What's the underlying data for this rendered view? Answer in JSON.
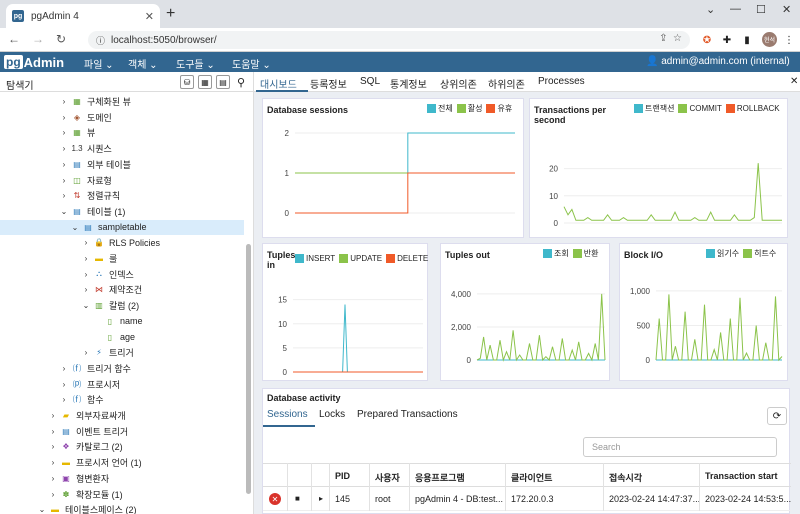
{
  "browser": {
    "tab_title": "pgAdmin 4",
    "favicon": "pg",
    "url": "localhost:5050/browser/",
    "profile_initials": "현석"
  },
  "navbar": {
    "logo_pg": "pg",
    "logo_admin": "Admin",
    "menus": [
      "파일 ⌄",
      "객체 ⌄",
      "도구들 ⌄",
      "도움말 ⌄"
    ],
    "user": "admin@admin.com (internal) ⌄"
  },
  "left_panel": {
    "title": "탐색기"
  },
  "tree": [
    {
      "label": "구체화된 뷰",
      "indent": 1,
      "chev": "›",
      "icon": "▦",
      "color": "#5c9e2f"
    },
    {
      "label": "도메인",
      "indent": 1,
      "chev": "›",
      "icon": "◈",
      "color": "#a0522d"
    },
    {
      "label": "뷰",
      "indent": 1,
      "chev": "›",
      "icon": "▦",
      "color": "#5c9e2f"
    },
    {
      "label": "시퀀스",
      "indent": 1,
      "chev": "›",
      "icon": "1.3",
      "color": "#333"
    },
    {
      "label": "외부 테이블",
      "indent": 1,
      "chev": "›",
      "icon": "▤",
      "color": "#2d7ab8"
    },
    {
      "label": "자료형",
      "indent": 1,
      "chev": "›",
      "icon": "◫",
      "color": "#5c9e2f"
    },
    {
      "label": "정렬규칙",
      "indent": 1,
      "chev": "›",
      "icon": "⇅",
      "color": "#c0392b"
    },
    {
      "label": "테이블 (1)",
      "indent": 1,
      "chev": "⌄",
      "icon": "▤",
      "color": "#2d7ab8"
    },
    {
      "label": "sampletable",
      "indent": 2,
      "chev": "⌄",
      "icon": "▤",
      "color": "#2d7ab8",
      "selected": true
    },
    {
      "label": "RLS Policies",
      "indent": 3,
      "chev": "›",
      "icon": "🔒",
      "color": "#5c9e2f"
    },
    {
      "label": "룰",
      "indent": 3,
      "chev": "›",
      "icon": "▬",
      "color": "#e6b800"
    },
    {
      "label": "인덱스",
      "indent": 3,
      "chev": "›",
      "icon": "⛬",
      "color": "#2d7ab8"
    },
    {
      "label": "제약조건",
      "indent": 3,
      "chev": "›",
      "icon": "⋈",
      "color": "#c0392b"
    },
    {
      "label": "칼럼 (2)",
      "indent": 3,
      "chev": "⌄",
      "icon": "▥",
      "color": "#5c9e2f"
    },
    {
      "label": "name",
      "indent": 4,
      "chev": "",
      "icon": "▯",
      "color": "#5c9e2f"
    },
    {
      "label": "age",
      "indent": 4,
      "chev": "",
      "icon": "▯",
      "color": "#5c9e2f"
    },
    {
      "label": "트리거",
      "indent": 3,
      "chev": "›",
      "icon": "⚡",
      "color": "#2d7ab8"
    },
    {
      "label": "트리거 함수",
      "indent": 1,
      "chev": "›",
      "icon": "⒡",
      "color": "#2d7ab8"
    },
    {
      "label": "프로시저",
      "indent": 1,
      "chev": "›",
      "icon": "⒫",
      "color": "#2d7ab8"
    },
    {
      "label": "함수",
      "indent": 1,
      "chev": "›",
      "icon": "⒡",
      "color": "#2d7ab8"
    },
    {
      "label": "외부자료싸개",
      "indent": 0,
      "chev": "›",
      "icon": "▰",
      "color": "#e6b800"
    },
    {
      "label": "이벤트 트리거",
      "indent": 0,
      "chev": "›",
      "icon": "▤",
      "color": "#2d7ab8"
    },
    {
      "label": "카탈로그 (2)",
      "indent": 0,
      "chev": "›",
      "icon": "❖",
      "color": "#8e44ad"
    },
    {
      "label": "프로시저 언어 (1)",
      "indent": 0,
      "chev": "›",
      "icon": "▬",
      "color": "#e6b800"
    },
    {
      "label": "형변환자",
      "indent": 0,
      "chev": "›",
      "icon": "▣",
      "color": "#8e44ad"
    },
    {
      "label": "확장모듈 (1)",
      "indent": 0,
      "chev": "›",
      "icon": "✽",
      "color": "#5c9e2f"
    },
    {
      "label": "테이블스페이스 (2)",
      "indent": -1,
      "chev": "⌄",
      "icon": "▬",
      "color": "#e6b800"
    }
  ],
  "dashboard_tabs": [
    "대시보드",
    "등록정보",
    "SQL",
    "통계정보",
    "상위의존",
    "하위의존",
    "Processes"
  ],
  "colors": {
    "total": "#3fb8cb",
    "active": "#8bc34a",
    "idle": "#f05a28",
    "navbar": "#326690"
  },
  "cards": {
    "sessions": {
      "title": "Database sessions",
      "legend": [
        "전체",
        "활성",
        "유휴"
      ]
    },
    "tps": {
      "title_1": "Transactions per",
      "title_2": "second",
      "legend": [
        "트랜잭션",
        "COMMIT",
        "ROLLBACK"
      ]
    },
    "tuples_in": {
      "title_1": "Tuples",
      "title_2": "in",
      "legend": [
        "INSERT",
        "UPDATE",
        "DELETE"
      ]
    },
    "tuples_out": {
      "title": "Tuples out",
      "legend": [
        "조회",
        "반환"
      ]
    },
    "block_io": {
      "title": "Block I/O",
      "legend": [
        "읽기수",
        "히트수"
      ]
    }
  },
  "chart_data": [
    {
      "type": "line",
      "title": "Database sessions",
      "y_ticks": [
        "2",
        "1",
        "0"
      ],
      "ylim": [
        0,
        2
      ],
      "series": [
        {
          "name": "전체",
          "color": "#3fb8cb",
          "values": [
            1,
            1,
            1,
            1,
            1,
            1,
            1,
            1,
            1,
            1,
            1,
            1,
            1,
            1,
            1,
            1,
            1,
            1,
            1,
            1,
            2,
            2,
            2,
            2,
            2,
            2,
            2,
            2,
            2,
            2,
            2,
            2,
            2,
            2,
            2,
            2,
            2,
            2,
            2,
            2
          ]
        },
        {
          "name": "활성",
          "color": "#8bc34a",
          "values": [
            1,
            1,
            1,
            1,
            1,
            1,
            1,
            1,
            1,
            1,
            1,
            1,
            1,
            1,
            1,
            1,
            1,
            1,
            1,
            1,
            1,
            1,
            1,
            1,
            1,
            1,
            1,
            1,
            1,
            1,
            1,
            1,
            1,
            1,
            1,
            1,
            1,
            1,
            1,
            1
          ]
        },
        {
          "name": "유휴",
          "color": "#f05a28",
          "values": [
            0,
            0,
            0,
            0,
            0,
            0,
            0,
            0,
            0,
            0,
            0,
            0,
            0,
            0,
            0,
            0,
            0,
            0,
            0,
            0,
            1,
            1,
            1,
            1,
            1,
            1,
            1,
            1,
            1,
            1,
            1,
            1,
            1,
            1,
            1,
            1,
            1,
            1,
            1,
            1
          ]
        }
      ]
    },
    {
      "type": "line",
      "title": "Transactions per second",
      "y_ticks": [
        "20",
        "10",
        "0"
      ],
      "ylim": [
        0,
        25
      ],
      "series": [
        {
          "name": "트랜잭션",
          "color": "#3fb8cb",
          "values": []
        },
        {
          "name": "COMMIT",
          "color": "#8bc34a",
          "values": [
            6,
            3,
            5,
            1,
            1,
            1,
            2,
            1,
            1,
            1,
            1,
            3,
            1,
            1,
            1,
            2,
            1,
            1,
            1,
            1,
            1,
            1,
            3,
            1,
            1,
            1,
            1,
            1,
            4,
            1,
            1,
            1,
            1,
            2,
            1,
            1,
            1,
            4,
            1,
            1,
            1,
            1,
            1,
            3,
            1,
            1,
            1,
            1,
            2,
            22,
            1,
            1,
            1,
            1,
            1,
            1
          ]
        },
        {
          "name": "ROLLBACK",
          "color": "#f05a28",
          "values": []
        }
      ]
    },
    {
      "type": "line",
      "title": "Tuples in",
      "y_ticks": [
        "15",
        "10",
        "5",
        "0"
      ],
      "ylim": [
        0,
        17
      ],
      "series": [
        {
          "name": "INSERT",
          "color": "#3fb8cb",
          "values": [
            0,
            0,
            0,
            0,
            0,
            0,
            0,
            0,
            0,
            0,
            0,
            0,
            0,
            0,
            0,
            0,
            0,
            0,
            0,
            0,
            0,
            0,
            14,
            0,
            0,
            0,
            0,
            0,
            0,
            0,
            0,
            0,
            0,
            0,
            0,
            0,
            0,
            0,
            0,
            0,
            0,
            0,
            0,
            0,
            0,
            0,
            0,
            0,
            0,
            0,
            0,
            0,
            0,
            0,
            0,
            0
          ]
        },
        {
          "name": "UPDATE",
          "color": "#8bc34a",
          "values": [
            0,
            0,
            0,
            0,
            0,
            0,
            0,
            0,
            0,
            0,
            0,
            0,
            0,
            0,
            0,
            0,
            0,
            0,
            0,
            0,
            0,
            0,
            0,
            0,
            0,
            0,
            0,
            0,
            0,
            0,
            0,
            0,
            0,
            0,
            0,
            0,
            0,
            0,
            0,
            0,
            0,
            0,
            0,
            0,
            0,
            0,
            0,
            0,
            0,
            0,
            0,
            0,
            0,
            0,
            0,
            0
          ]
        },
        {
          "name": "DELETE",
          "color": "#f05a28",
          "values": [
            0,
            0,
            0,
            0,
            0,
            0,
            0,
            0,
            0,
            0,
            0,
            0,
            0,
            0,
            0,
            0,
            0,
            0,
            0,
            0,
            0,
            0,
            0,
            0,
            0,
            0,
            0,
            0,
            0,
            0,
            0,
            0,
            0,
            0,
            0,
            0,
            0,
            0,
            0,
            0,
            0,
            0,
            0,
            0,
            0,
            0,
            0,
            0,
            0,
            0,
            0,
            0,
            0,
            0,
            0,
            0
          ]
        }
      ]
    },
    {
      "type": "line",
      "title": "Tuples out",
      "y_ticks": [
        "4,000",
        "2,000",
        "0"
      ],
      "ylim": [
        0,
        4600
      ],
      "series": [
        {
          "name": "조회",
          "color": "#3fb8cb",
          "values": [
            0,
            0,
            0,
            0,
            0,
            0,
            0,
            0,
            0,
            0,
            0,
            0,
            0,
            0,
            0,
            0,
            0,
            0,
            0,
            0,
            0,
            0,
            0,
            0,
            0,
            0,
            0,
            0,
            0,
            0,
            0,
            0,
            0,
            0,
            0,
            0,
            0,
            0,
            0,
            0
          ]
        },
        {
          "name": "반환",
          "color": "#8bc34a",
          "values": [
            0,
            100,
            1400,
            0,
            900,
            0,
            0,
            1200,
            0,
            500,
            0,
            1800,
            0,
            300,
            0,
            0,
            1000,
            0,
            0,
            1500,
            0,
            200,
            0,
            800,
            0,
            0,
            1300,
            0,
            0,
            600,
            0,
            1100,
            0,
            0,
            400,
            0,
            1000,
            0,
            4000,
            0
          ]
        }
      ]
    },
    {
      "type": "line",
      "title": "Block I/O",
      "y_ticks": [
        "1,000",
        "500",
        "0"
      ],
      "ylim": [
        0,
        1100
      ],
      "series": [
        {
          "name": "읽기수",
          "color": "#3fb8cb",
          "values": [
            0,
            0,
            0,
            0,
            0,
            0,
            0,
            0,
            0,
            0,
            0,
            0,
            0,
            0,
            0,
            0,
            0,
            0,
            0,
            0,
            0,
            0,
            0,
            0,
            0,
            0,
            0,
            0,
            0,
            0,
            0,
            0,
            0,
            0,
            0,
            0,
            0,
            0,
            0,
            0
          ]
        },
        {
          "name": "히트수",
          "color": "#8bc34a",
          "values": [
            0,
            600,
            0,
            0,
            950,
            0,
            200,
            0,
            0,
            700,
            0,
            0,
            300,
            0,
            0,
            800,
            0,
            0,
            150,
            0,
            400,
            0,
            0,
            600,
            0,
            0,
            900,
            0,
            100,
            0,
            0,
            500,
            0,
            0,
            250,
            0,
            0,
            920,
            0,
            50
          ]
        }
      ]
    }
  ],
  "activity": {
    "title": "Database activity",
    "tabs": [
      "Sessions",
      "Locks",
      "Prepared Transactions"
    ],
    "search_placeholder": "Search",
    "columns": [
      "PID",
      "사용자",
      "응용프로그램",
      "클라이언트",
      "접속시각",
      "Transaction start"
    ],
    "row": {
      "pid": "145",
      "user": "root",
      "app": "pgAdmin 4 - DB:test...",
      "client": "172.20.0.3",
      "conn_time": "2023-02-24 14:47:37...",
      "tx_start": "2023-02-24 14:53:5..."
    }
  }
}
